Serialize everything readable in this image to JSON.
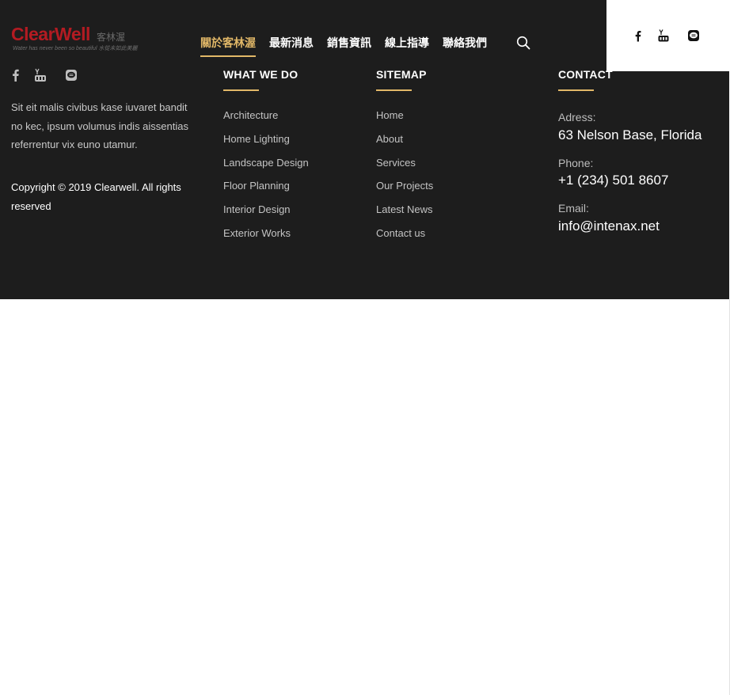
{
  "logo": {
    "name": "ClearWell",
    "cn": "客林渥",
    "tagline": "Water has never been so beautiful  水從未如此美麗"
  },
  "nav": {
    "items": [
      {
        "label": "關於客林渥",
        "active": true
      },
      {
        "label": "最新消息",
        "active": false
      },
      {
        "label": "銷售資訊",
        "active": false
      },
      {
        "label": "線上指導",
        "active": false
      },
      {
        "label": "聯絡我們",
        "active": false
      }
    ],
    "search_icon": "search-icon"
  },
  "header_social": [
    "facebook-icon",
    "youtube-icon",
    "line-icon"
  ],
  "footer": {
    "social": [
      "facebook-icon",
      "youtube-icon",
      "line-icon"
    ],
    "about": "Sit eit malis civibus kase iuvaret bandit no kec, ipsum volumus indis aissentias referrentur vix euno utamur.",
    "copyright": "Copyright © 2019 Clearwell. All rights reserved",
    "what_we_do": {
      "title": "WHAT WE DO",
      "links": [
        "Architecture",
        "Home Lighting",
        "Landscape Design",
        "Floor Planning",
        "Interior Design",
        "Exterior Works"
      ]
    },
    "sitemap": {
      "title": "SITEMAP",
      "links": [
        "Home",
        "About",
        "Services",
        "Our Projects",
        "Latest News",
        "Contact us"
      ]
    },
    "contact": {
      "title": "CONTACT",
      "address_label": "Adress:",
      "address": "63 Nelson Base, Florida",
      "phone_label": "Phone:",
      "phone": "+1 (234) 501 8607",
      "email_label": "Email:",
      "email": "info@intenax.net"
    }
  },
  "colors": {
    "background": "#1d1d1d",
    "accent": "#e2b868",
    "brand": "#b31b22"
  }
}
